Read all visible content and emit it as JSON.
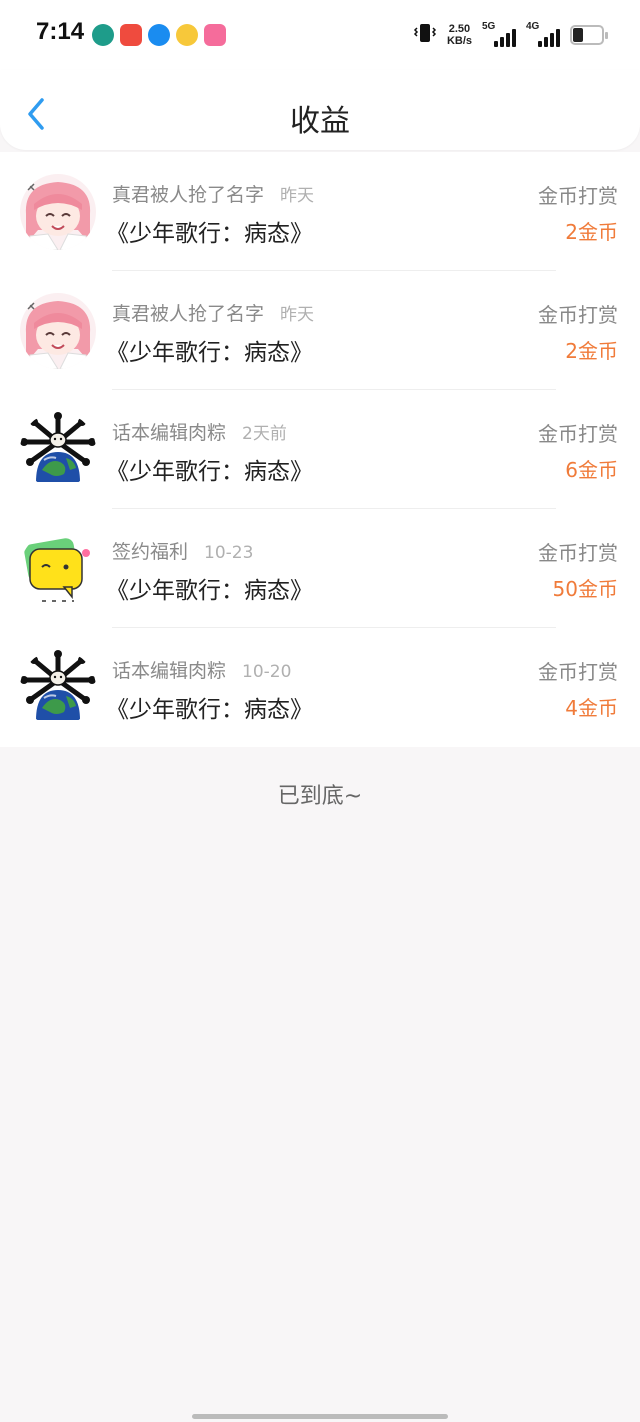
{
  "status_bar": {
    "time": "7:14",
    "notification_icons": [
      "phone-app-icon",
      "taobao-icon",
      "alipay-icon",
      "weibo-icon",
      "bilibili-icon"
    ],
    "speed_value": "2.50",
    "speed_unit": "KB/s",
    "net1": "5G",
    "net2": "4G"
  },
  "header": {
    "title": "收益"
  },
  "items": [
    {
      "name": "真君被人抢了名字",
      "date": "昨天",
      "book": "《少年歌行：病态》",
      "type": "金币打赏",
      "amount": "2金币",
      "avatar": "anime-girl-avatar"
    },
    {
      "name": "真君被人抢了名字",
      "date": "昨天",
      "book": "《少年歌行：病态》",
      "type": "金币打赏",
      "amount": "2金币",
      "avatar": "anime-girl-avatar"
    },
    {
      "name": "话本编辑肉粽",
      "date": "2天前",
      "book": "《少年歌行：病态》",
      "type": "金币打赏",
      "amount": "6金币",
      "avatar": "earth-dog-avatar"
    },
    {
      "name": "签约福利",
      "date": "10-23",
      "book": "《少年歌行：病态》",
      "type": "金币打赏",
      "amount": "50金币",
      "avatar": "yellow-chat-bubble-avatar"
    },
    {
      "name": "话本编辑肉粽",
      "date": "10-20",
      "book": "《少年歌行：病态》",
      "type": "金币打赏",
      "amount": "4金币",
      "avatar": "earth-dog-avatar"
    }
  ],
  "footer": {
    "end_text": "已到底~"
  },
  "colors": {
    "amount": "#f07b3a",
    "back_arrow": "#2f9cf0",
    "page_bg": "#f8f6f7"
  }
}
